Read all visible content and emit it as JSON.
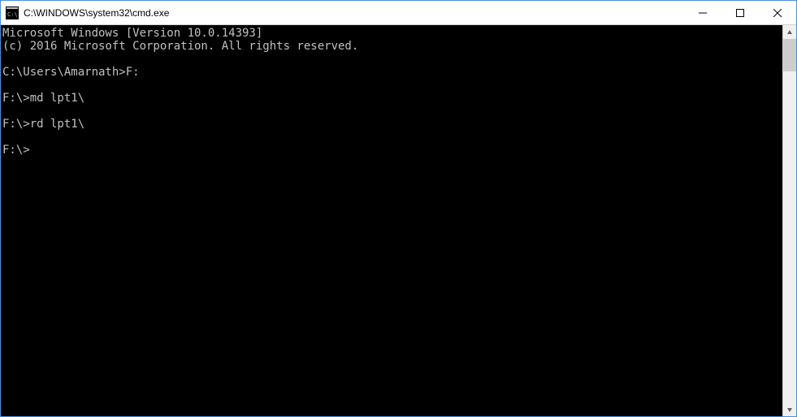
{
  "window": {
    "title": "C:\\WINDOWS\\system32\\cmd.exe"
  },
  "console": {
    "lines": [
      "Microsoft Windows [Version 10.0.14393]",
      "(c) 2016 Microsoft Corporation. All rights reserved.",
      "",
      "C:\\Users\\Amarnath>F:",
      "",
      "F:\\>md lpt1\\",
      "",
      "F:\\>rd lpt1\\",
      "",
      "F:\\>"
    ]
  }
}
